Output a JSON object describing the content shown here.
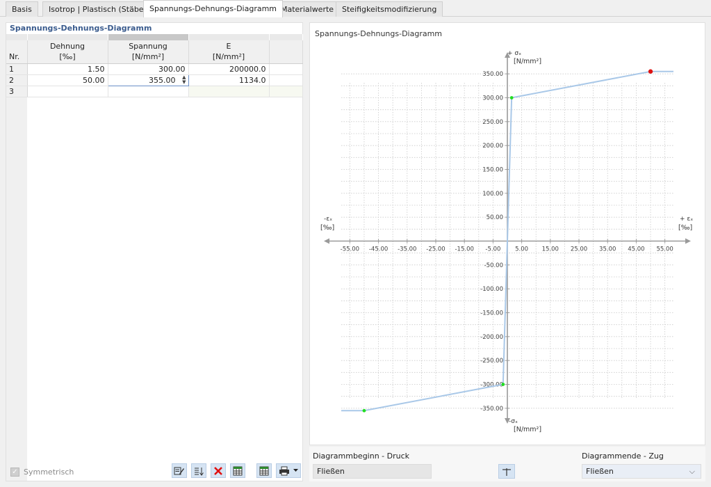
{
  "tabs": [
    {
      "label": "Basis"
    },
    {
      "label": "Isotrop | Plastisch (Stäbe)"
    },
    {
      "label": "Spannungs-Dehnungs-Diagramm"
    },
    {
      "label": "Materialwerte"
    },
    {
      "label": "Steifigkeitsmodifizierung"
    }
  ],
  "left": {
    "title": "Spannungs-Dehnungs-Diagramm",
    "columns": {
      "nr": "Nr.",
      "dehnung": "Dehnung",
      "dehnung_unit": "[‰]",
      "spannung": "Spannung",
      "spannung_unit": "[N/mm²]",
      "e": "E",
      "e_unit": "[N/mm²]"
    },
    "rows": [
      {
        "nr": "1",
        "dehnung": "1.50",
        "spannung": "300.00",
        "e": "200000.0"
      },
      {
        "nr": "2",
        "dehnung": "50.00",
        "spannung": "355.00",
        "e": "1134.0"
      },
      {
        "nr": "3",
        "dehnung": "",
        "spannung": "",
        "e": ""
      }
    ],
    "symmetric_label": "Symmetrisch",
    "symmetric_checked": true
  },
  "chart": {
    "panel_title": "Spannungs-Dehnungs-Diagramm",
    "y_axis_pos_label": "+ σₓ",
    "y_axis_pos_unit": "[N/mm²]",
    "y_axis_neg_label": "-σₓ",
    "y_axis_neg_unit": "[N/mm²]",
    "x_axis_pos_label": "+ εₓ",
    "x_axis_pos_unit": "[‰]",
    "x_axis_neg_label": "-εₓ",
    "x_axis_neg_unit": "[‰]",
    "line_color": "#a9c8e8",
    "point_color": "#22dd22",
    "end_point_color": "#dd1111"
  },
  "chart_data": {
    "type": "line",
    "x_ticks": [
      "-55.00",
      "-45.00",
      "-35.00",
      "-25.00",
      "-15.00",
      "-5.00",
      "5.00",
      "15.00",
      "25.00",
      "35.00",
      "45.00",
      "55.00"
    ],
    "y_ticks": [
      "350.00",
      "300.00",
      "250.00",
      "200.00",
      "150.00",
      "100.00",
      "50.00",
      "-50.00",
      "-100.00",
      "-150.00",
      "-200.00",
      "-250.00",
      "-300.00",
      "-350.00"
    ],
    "xlim": [
      -58,
      58
    ],
    "ylim": [
      -375,
      375
    ],
    "grid": true,
    "series": [
      {
        "x": [
          -58,
          -50,
          -1.5,
          0,
          1.5,
          50,
          58
        ],
        "y": [
          -355,
          -355,
          -300,
          0,
          300,
          355,
          355
        ]
      }
    ],
    "markers": [
      {
        "x": -50,
        "y": -355,
        "kind": "point"
      },
      {
        "x": -1.5,
        "y": -300,
        "kind": "point"
      },
      {
        "x": 1.5,
        "y": 300,
        "kind": "point"
      },
      {
        "x": 50,
        "y": 355,
        "kind": "end"
      }
    ]
  },
  "bottom": {
    "start_label": "Diagrammbeginn - Druck",
    "start_value": "Fließen",
    "end_label": "Diagrammende - Zug",
    "end_value": "Fließen"
  }
}
